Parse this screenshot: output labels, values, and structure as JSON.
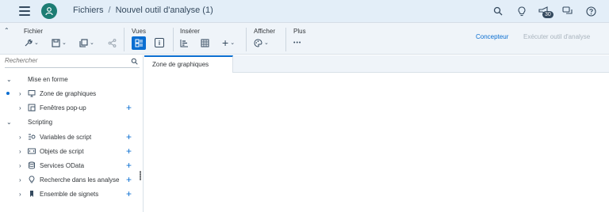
{
  "shell": {
    "breadcrumb_root": "Fichiers",
    "breadcrumb_separator": "/",
    "breadcrumb_current": "Nouvel outil d'analyse (1)",
    "notification_count": "30"
  },
  "toolbar": {
    "groups": {
      "file": "Fichier",
      "views": "Vues",
      "insert": "Insérer",
      "display": "Afficher",
      "more": "Plus"
    },
    "more_glyph": "•••",
    "designer": "Concepteur",
    "run": "Exécuter outil d'analyse"
  },
  "sidebar": {
    "search_placeholder": "Rechercher",
    "items": [
      {
        "label": "Mise en forme",
        "icon": "chevron-down-icon"
      },
      {
        "label": "Zone de graphiques",
        "icon": "monitor-icon"
      },
      {
        "label": "Fenêtres pop-up",
        "icon": "popup-icon"
      },
      {
        "label": "Scripting",
        "icon": "chevron-down-icon"
      },
      {
        "label": "Variables de script",
        "icon": "variable-icon"
      },
      {
        "label": "Objets de script",
        "icon": "script-object-icon"
      },
      {
        "label": "Services OData",
        "icon": "database-icon"
      },
      {
        "label": "Recherche dans les analyse",
        "icon": "lightbulb-icon"
      },
      {
        "label": "Ensemble de signets",
        "icon": "bookmark-icon"
      }
    ]
  },
  "tabs": [
    {
      "label": "Zone de graphiques"
    }
  ],
  "colors": {
    "accent": "#0a6ed1",
    "shell_bg": "#e3eef8",
    "avatar": "#1d7d74"
  }
}
